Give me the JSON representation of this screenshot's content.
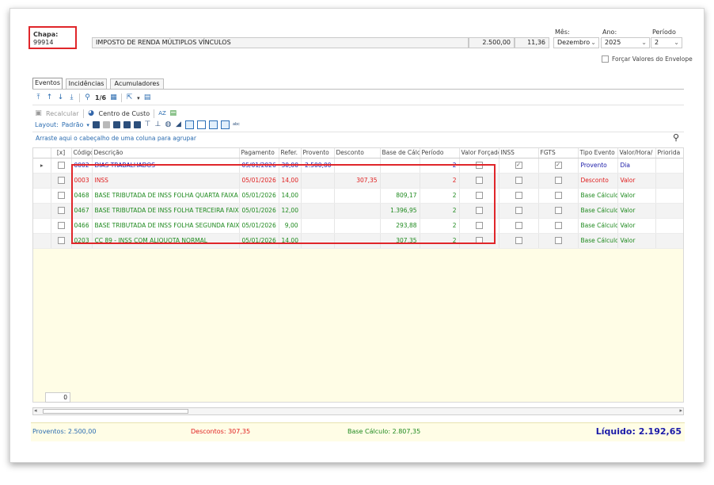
{
  "header": {
    "chapa_label": "Chapa:",
    "chapa_value": "99914",
    "description": "IMPOSTO DE RENDA MÚLTIPLOS VÍNCULOS",
    "value1": "2.500,00",
    "value2": "11,36",
    "mes_label": "Mês:",
    "mes_value": "Dezembro",
    "ano_label": "Ano:",
    "ano_value": "2025",
    "periodo_label": "Período",
    "periodo_value": "2",
    "forcar_label": "Forçar Valores do Envelope"
  },
  "tabs": [
    "Eventos",
    "Incidências",
    "Acumuladores"
  ],
  "toolbar1": {
    "page": "1/6"
  },
  "toolbar2": {
    "recalcular": "Recalcular",
    "centro_custo": "Centro de Custo"
  },
  "toolbar3": {
    "layout": "Layout:",
    "padrao": "Padrão"
  },
  "group_hint": "Arraste aqui o cabeçalho de uma coluna para agrupar",
  "columns": [
    "[x]",
    "Código",
    "Descrição",
    "Pagamento",
    "Refer.",
    "Provento",
    "Desconto",
    "Base de Cálc",
    "Período",
    "Valor Forçado",
    "INSS",
    "FGTS",
    "Tipo Evento",
    "Valor/Hora/",
    "Priorida"
  ],
  "rows": [
    {
      "codigo": "0002",
      "descricao": "DIAS TRABALHADOS",
      "pagamento": "05/01/2026",
      "refer": "30,00",
      "provento": "2.500,00",
      "desconto": "",
      "base": "",
      "periodo": "2",
      "inss": true,
      "fgts": true,
      "tipo": "Provento",
      "valor": "Dia",
      "color": "blue"
    },
    {
      "codigo": "0003",
      "descricao": "INSS",
      "pagamento": "05/01/2026",
      "refer": "14,00",
      "provento": "",
      "desconto": "307,35",
      "base": "",
      "periodo": "2",
      "inss": false,
      "fgts": false,
      "tipo": "Desconto",
      "valor": "Valor",
      "color": "red"
    },
    {
      "codigo": "0468",
      "descricao": "BASE TRIBUTADA DE INSS FOLHA QUARTA FAIXA",
      "pagamento": "05/01/2026",
      "refer": "14,00",
      "provento": "",
      "desconto": "",
      "base": "809,17",
      "periodo": "2",
      "inss": false,
      "fgts": false,
      "tipo": "Base Cálculo",
      "valor": "Valor",
      "color": "green"
    },
    {
      "codigo": "0467",
      "descricao": "BASE TRIBUTADA DE INSS FOLHA TERCEIRA FAIXA",
      "pagamento": "05/01/2026",
      "refer": "12,00",
      "provento": "",
      "desconto": "",
      "base": "1.396,95",
      "periodo": "2",
      "inss": false,
      "fgts": false,
      "tipo": "Base Cálculo",
      "valor": "Valor",
      "color": "green"
    },
    {
      "codigo": "0466",
      "descricao": "BASE TRIBUTADA DE INSS FOLHA SEGUNDA FAIXA",
      "pagamento": "05/01/2026",
      "refer": "9,00",
      "provento": "",
      "desconto": "",
      "base": "293,88",
      "periodo": "2",
      "inss": false,
      "fgts": false,
      "tipo": "Base Cálculo",
      "valor": "Valor",
      "color": "green"
    },
    {
      "codigo": "0203",
      "descricao": "CC 89 - INSS COM ALIQUOTA NORMAL",
      "pagamento": "05/01/2026",
      "refer": "14,00",
      "provento": "",
      "desconto": "",
      "base": "307,35",
      "periodo": "2",
      "inss": false,
      "fgts": false,
      "tipo": "Base Cálculo",
      "valor": "Valor",
      "color": "green"
    }
  ],
  "footer_count": "0",
  "totals": {
    "proventos_label": "Proventos:",
    "proventos": "2.500,00",
    "descontos_label": "Descontos:",
    "descontos": "307,35",
    "base_label": "Base Cálculo:",
    "base": "2.807,35",
    "liquido_label": "Líquido:",
    "liquido": "2.192,65"
  },
  "colors": {
    "blue": "#1a1aa8",
    "red": "#e02020",
    "green": "#1f8a1f",
    "highlight": "#e0262a",
    "empty_area": "#fffde6"
  }
}
